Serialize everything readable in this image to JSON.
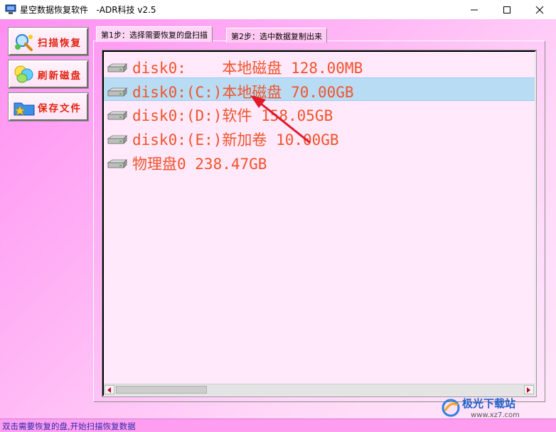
{
  "window": {
    "title": "星空数据恢复软件   -ADR科技 v2.5",
    "icon": "app-drive-icon"
  },
  "sidebar": {
    "buttons": [
      {
        "label": "扫描恢复",
        "icon": "scan-magnifier-icon"
      },
      {
        "label": "刷新磁盘",
        "icon": "refresh-balloons-icon"
      },
      {
        "label": "保存文件",
        "icon": "save-folder-icon"
      }
    ]
  },
  "tabs": [
    {
      "label": "第1步：选择需要恢复的盘扫描",
      "active": true
    },
    {
      "label": "第2步：选中数据复制出来",
      "active": false
    }
  ],
  "disks": [
    {
      "text": "disk0:    本地磁盘 128.00MB",
      "selected": false
    },
    {
      "text": "disk0:(C:)本地磁盘 70.00GB",
      "selected": true
    },
    {
      "text": "disk0:(D:)软件 158.05GB",
      "selected": false
    },
    {
      "text": "disk0:(E:)新加卷 10.00GB",
      "selected": false
    },
    {
      "text": "物理盘0 238.47GB",
      "selected": false
    }
  ],
  "status": {
    "text": "双击需要恢复的盘,开始扫描恢复数据"
  },
  "watermark": {
    "text": "极光下载站",
    "url": "www.xz7.com"
  },
  "colors": {
    "accent_text": "#f0542a",
    "button_text": "#e0240f",
    "selected_row": "#b9dcf5",
    "annotation_arrow": "#e0192b"
  }
}
